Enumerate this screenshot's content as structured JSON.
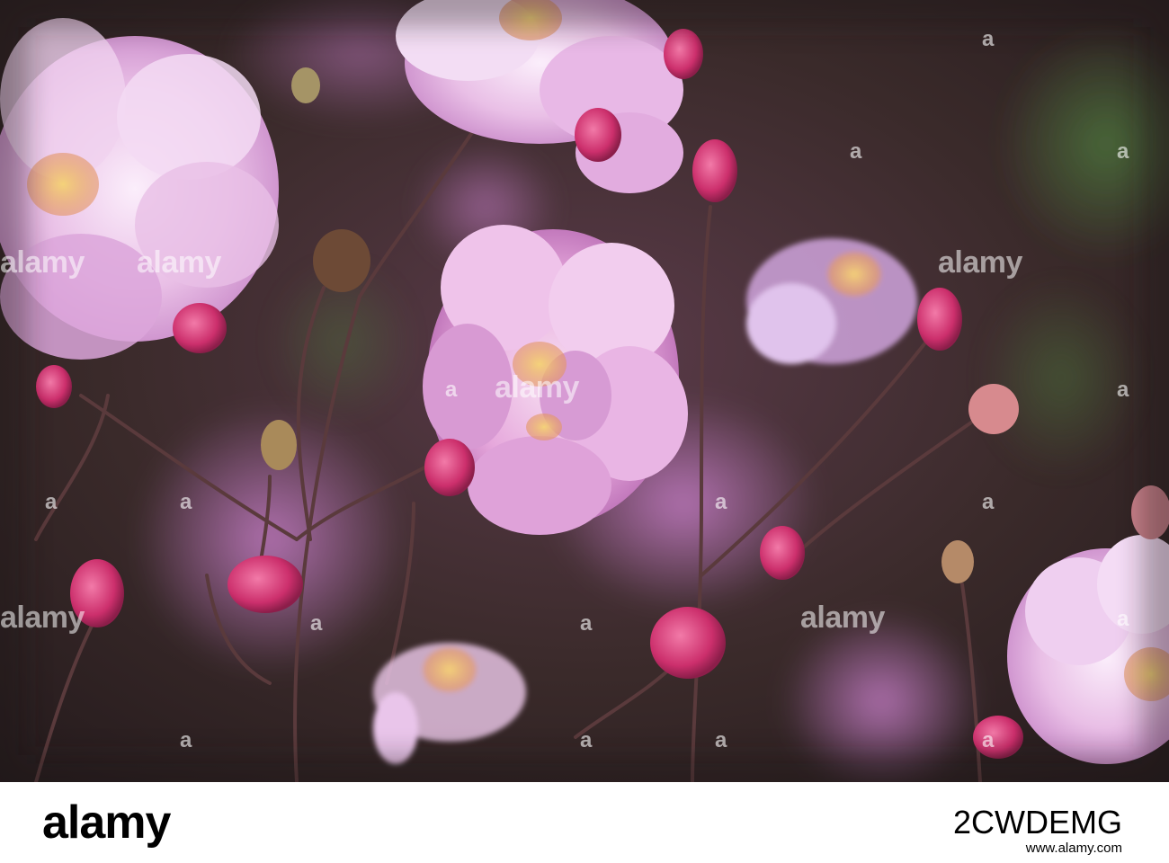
{
  "photo": {
    "subject": "pink rose blossoms and buds",
    "colors": {
      "background": "#2e1f24",
      "petal": "#e6b8e4",
      "bud": "#d83a78",
      "stem": "#5a3a3a"
    }
  },
  "watermark": {
    "text": "alamy",
    "mark": "a"
  },
  "footer": {
    "logo": "alamy",
    "image_id": "2CWDEMG",
    "url": "www.alamy.com"
  }
}
